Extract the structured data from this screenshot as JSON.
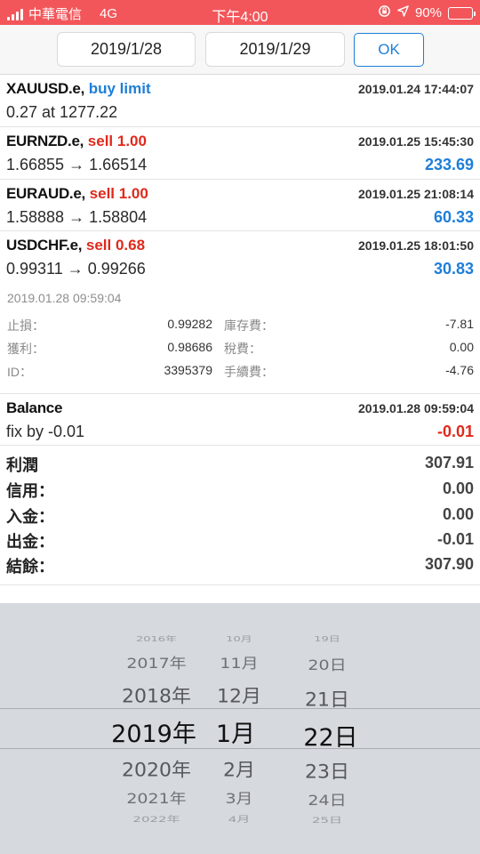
{
  "status_bar": {
    "carrier": "中華電信",
    "network": "4G",
    "time": "下午4:00",
    "battery_percent": "90%",
    "battery_level": 0.9,
    "icons": [
      "signal-icon",
      "rotation-lock-icon",
      "location-icon",
      "battery-icon"
    ]
  },
  "date_range": {
    "from": "2019/1/28",
    "to": "2019/1/29",
    "ok_label": "OK"
  },
  "orders": [
    {
      "symbol": "XAUUSD.e,",
      "action": "buy limit",
      "action_color": "blue",
      "time": "2019.01.24 17:44:07",
      "detail": "0.27 at 1277.22",
      "value": ""
    },
    {
      "symbol": "EURNZD.e,",
      "action": "sell 1.00",
      "action_color": "red",
      "time": "2019.01.25 15:45:30",
      "detail": "1.66855 → 1.66514",
      "value": "233.69"
    },
    {
      "symbol": "EURAUD.e,",
      "action": "sell 1.00",
      "action_color": "red",
      "time": "2019.01.25 21:08:14",
      "detail": "1.58888 → 1.58804",
      "value": "60.33"
    },
    {
      "symbol": "USDCHF.e,",
      "action": "sell 0.68",
      "action_color": "red",
      "time": "2019.01.25 18:01:50",
      "detail": "0.99311 → 0.99266",
      "value": "30.83"
    }
  ],
  "order_detail": {
    "close_time": "2019.01.28 09:59:04",
    "stop_loss_label": "止損：",
    "stop_loss": "0.99282",
    "swap_label": "庫存費：",
    "swap": "-7.81",
    "take_profit_label": "獲利：",
    "take_profit": "0.98686",
    "tax_label": "稅費：",
    "tax": "0.00",
    "id_label": "ID：",
    "id": "3395379",
    "commission_label": "手續費：",
    "commission": "-4.76"
  },
  "balance": {
    "title": "Balance",
    "time": "2019.01.28 09:59:04",
    "detail": "fix by -0.01",
    "value": "-0.01"
  },
  "summary": [
    {
      "label": "利潤",
      "value": "307.91"
    },
    {
      "label": "信用：",
      "value": "0.00"
    },
    {
      "label": "入金：",
      "value": "0.00"
    },
    {
      "label": "出金：",
      "value": "-0.01"
    },
    {
      "label": "結餘：",
      "value": "307.90"
    }
  ],
  "picker": {
    "years": [
      "2016年",
      "2017年",
      "2018年",
      "2019年",
      "2020年",
      "2021年",
      "2022年"
    ],
    "months": [
      "10月",
      "11月",
      "12月",
      "1月",
      "2月",
      "3月",
      "4月"
    ],
    "days": [
      "19日",
      "20日",
      "21日",
      "22日",
      "23日",
      "24日",
      "25日"
    ],
    "selected": {
      "year": "2019年",
      "month": "1月",
      "day": "22日"
    }
  },
  "colors": {
    "status_bar": "#f2565a",
    "accent_blue": "#1e7ed8",
    "loss_red": "#e0291b",
    "picker_bg": "#d6d9de"
  }
}
